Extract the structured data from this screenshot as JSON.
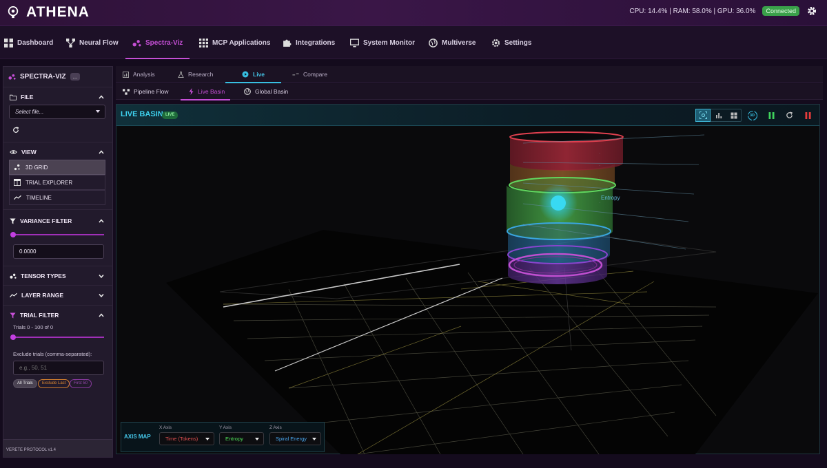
{
  "app": {
    "name": "ATHENA",
    "stats": "CPU: 14.4% | RAM: 58.0% | GPU: 36.0%",
    "connection": "Connected",
    "colors": {
      "accent": "#c64fd6",
      "cyan": "#3fd3f0",
      "success": "#3aa04a"
    }
  },
  "nav": [
    {
      "label": "Dashboard",
      "icon": "grid-icon"
    },
    {
      "label": "Neural Flow",
      "icon": "flow-icon"
    },
    {
      "label": "Spectra-Viz",
      "icon": "dots-icon",
      "active": true
    },
    {
      "label": "MCP Applications",
      "icon": "apps-icon"
    },
    {
      "label": "Integrations",
      "icon": "puzzle-icon"
    },
    {
      "label": "System Monitor",
      "icon": "monitor-icon"
    },
    {
      "label": "Multiverse",
      "icon": "globe-icon"
    },
    {
      "label": "Settings",
      "icon": "gear-icon"
    }
  ],
  "sidebar": {
    "title": "SPECTRA-VIZ",
    "more": "...",
    "file": {
      "title": "FILE",
      "select_placeholder": "Select file..."
    },
    "view": {
      "title": "VIEW",
      "items": [
        "3D GRID",
        "TRIAL EXPLORER",
        "TIMELINE"
      ]
    },
    "variance": {
      "title": "VARIANCE FILTER",
      "value": "0.0000",
      "slider": 0
    },
    "tensor": {
      "title": "TENSOR TYPES"
    },
    "layer": {
      "title": "LAYER RANGE"
    },
    "trial": {
      "title": "TRIAL FILTER",
      "range_text": "Trials 0 - 100 of 0",
      "slider": 0,
      "exclude_label": "Exclude trials (comma-separated):",
      "exclude_placeholder": "e.g., 50, 51",
      "chips": [
        "All Trials",
        "Exclude Last",
        "First 50"
      ]
    },
    "footer": "VERETE PROTOCOL v1.4"
  },
  "tabs": [
    "Analysis",
    "Research",
    "Live",
    "Compare"
  ],
  "active_tab": "Live",
  "subtabs": [
    "Pipeline Flow",
    "Live Basin",
    "Global Basin"
  ],
  "active_subtab": "Live Basin",
  "panel": {
    "title": "LIVE BASIN",
    "badge": "LIVE",
    "toolbar_3d": "3D",
    "scene_label": "Entropy"
  },
  "axis_map": {
    "title": "AXIS MAP",
    "x": {
      "label": "X Axis",
      "value": "Time (Tokens)",
      "color": "#e05050"
    },
    "y": {
      "label": "Y Axis",
      "value": "Entropy",
      "color": "#4fe05a"
    },
    "z": {
      "label": "Z Axis",
      "value": "Spiral Energy",
      "color": "#4aa8f0"
    }
  }
}
